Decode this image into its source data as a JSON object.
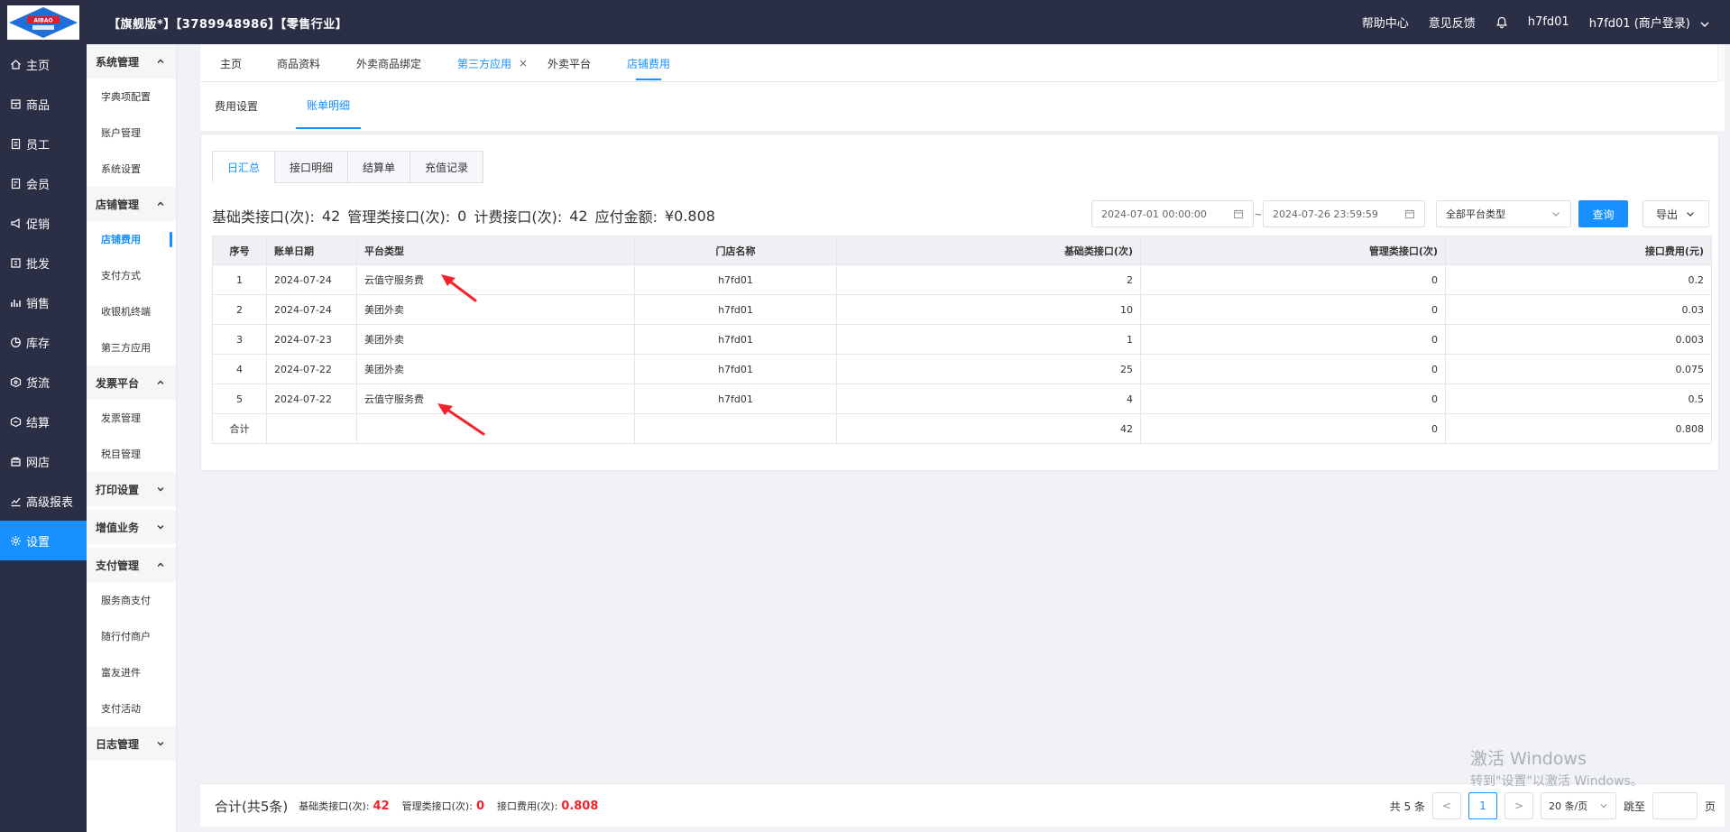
{
  "header": {
    "logo_text": "AIBAO",
    "title": "【旗舰版*】【3789948986】【零售行业】",
    "help": "帮助中心",
    "feedback": "意见反馈",
    "user": "h7fd01",
    "account": "h7fd01 (商户登录)"
  },
  "leftnav": [
    {
      "label": "主页",
      "icon": "home-icon"
    },
    {
      "label": "商品",
      "icon": "goods-icon"
    },
    {
      "label": "员工",
      "icon": "staff-icon"
    },
    {
      "label": "会员",
      "icon": "member-icon"
    },
    {
      "label": "促销",
      "icon": "promotion-icon"
    },
    {
      "label": "批发",
      "icon": "wholesale-icon"
    },
    {
      "label": "销售",
      "icon": "sales-icon"
    },
    {
      "label": "库存",
      "icon": "stock-icon"
    },
    {
      "label": "货流",
      "icon": "logistics-icon"
    },
    {
      "label": "结算",
      "icon": "settle-icon"
    },
    {
      "label": "网店",
      "icon": "shop-icon"
    },
    {
      "label": "高级报表",
      "icon": "report-icon"
    },
    {
      "label": "设置",
      "icon": "gear-icon",
      "active": true
    }
  ],
  "subnav": {
    "sys": {
      "title": "系统管理",
      "items": [
        "字典项配置",
        "账户管理",
        "系统设置"
      ]
    },
    "store": {
      "title": "店铺管理",
      "items": [
        "店铺费用",
        "支付方式",
        "收银机终端",
        "第三方应用"
      ]
    },
    "invoice": {
      "title": "发票平台",
      "items": [
        "发票管理",
        "税目管理"
      ]
    },
    "print": {
      "title": "打印设置"
    },
    "vas": {
      "title": "增值业务"
    },
    "pay": {
      "title": "支付管理",
      "items": [
        "服务商支付",
        "随行付商户",
        "富友进件",
        "支付活动"
      ]
    },
    "log": {
      "title": "日志管理"
    }
  },
  "tabs": [
    "主页",
    "商品资料",
    "外卖商品绑定",
    "第三方应用",
    "外卖平台",
    "店铺费用"
  ],
  "tab_close": "×",
  "sectabs": [
    "费用设置",
    "账单明细"
  ],
  "subtabs": [
    "日汇总",
    "接口明细",
    "结算单",
    "充值记录"
  ],
  "summary": {
    "basic_label": "基础类接口(次):",
    "basic_value": "42",
    "mgmt_label": "管理类接口(次):",
    "mgmt_value": "0",
    "billing_label": "计费接口(次):",
    "billing_value": "42",
    "amount_label": "应付金额:",
    "amount_value": "¥0.808"
  },
  "filters": {
    "start": "2024-07-01 00:00:00",
    "tilde": "~",
    "end": "2024-07-26 23:59:59",
    "platform": "全部平台类型",
    "query": "查询",
    "export": "导出"
  },
  "table": {
    "headers": [
      "序号",
      "账单日期",
      "平台类型",
      "门店名称",
      "基础类接口(次)",
      "管理类接口(次)",
      "接口费用(元)"
    ],
    "rows": [
      [
        "1",
        "2024-07-24",
        "云值守服务费",
        "h7fd01",
        "2",
        "0",
        "0.2"
      ],
      [
        "2",
        "2024-07-24",
        "美团外卖",
        "h7fd01",
        "10",
        "0",
        "0.03"
      ],
      [
        "3",
        "2024-07-23",
        "美团外卖",
        "h7fd01",
        "1",
        "0",
        "0.003"
      ],
      [
        "4",
        "2024-07-22",
        "美团外卖",
        "h7fd01",
        "25",
        "0",
        "0.075"
      ],
      [
        "5",
        "2024-07-22",
        "云值守服务费",
        "h7fd01",
        "4",
        "0",
        "0.5"
      ]
    ],
    "total": [
      "合计",
      "",
      "",
      "",
      "42",
      "0",
      "0.808"
    ]
  },
  "footer": {
    "total_label": "合计(共5条)",
    "basic_label": "基础类接口(次):",
    "basic_value": "42",
    "mgmt_label": "管理类接口(次):",
    "mgmt_value": "0",
    "fee_label": "接口费用(次):",
    "fee_value": "0.808",
    "count": "共 5 条",
    "prev": "<",
    "page": "1",
    "next": ">",
    "page_size": "20 条/页",
    "jump_label": "跳至",
    "page_unit": "页"
  },
  "watermark": {
    "line1": "激活 Windows",
    "line2": "转到\"设置\"以激活 Windows。"
  },
  "colors": {
    "header_bg": "#2b2f45",
    "accent": "#1890ff",
    "annotation_arrow": "#f5222d"
  }
}
